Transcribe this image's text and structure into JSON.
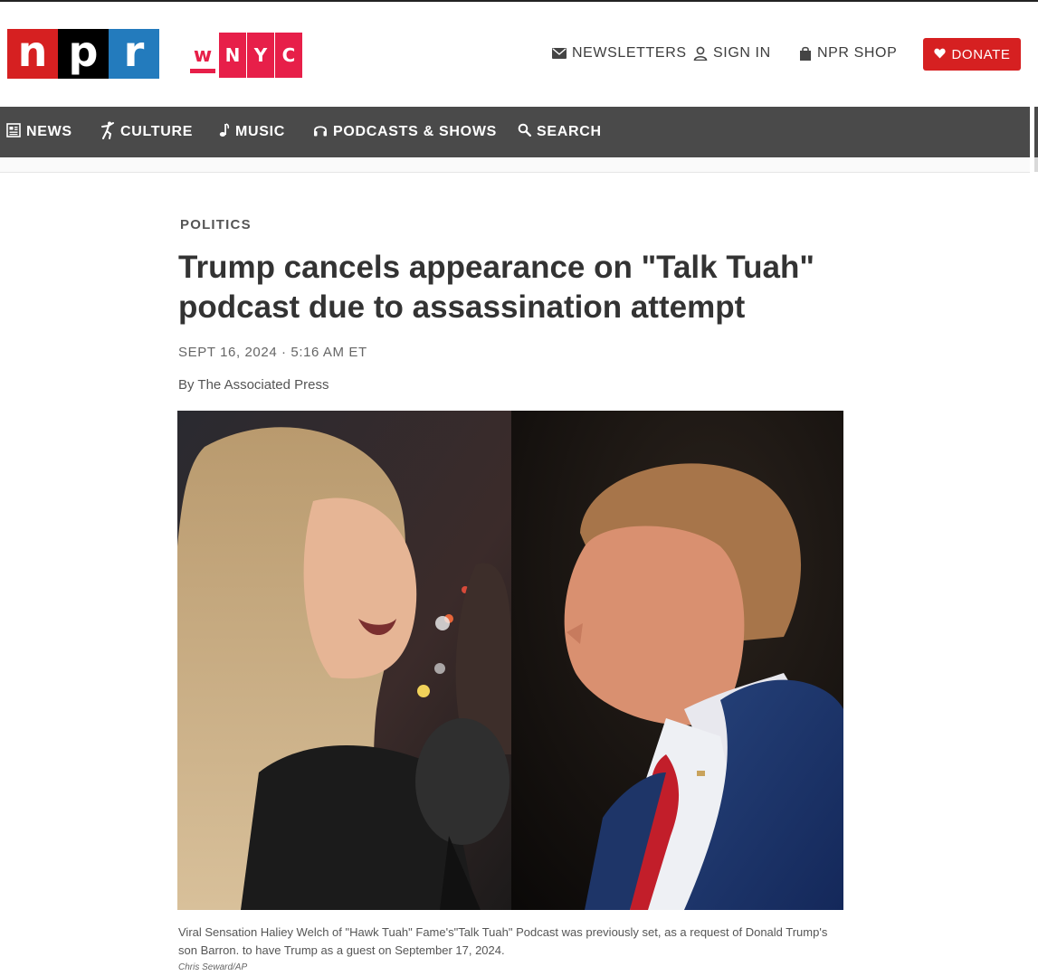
{
  "brand": {
    "npr_letters": [
      "n",
      "p",
      "r"
    ],
    "wnyc_letters": [
      "w",
      "N",
      "Y",
      "C"
    ],
    "colors": {
      "npr_red": "#d62021",
      "npr_black": "#000000",
      "npr_blue": "#237bbd",
      "wnyc_pink": "#e71f49",
      "nav_bg": "#4a4a4a"
    }
  },
  "utility": {
    "newsletters": "NEWSLETTERS",
    "sign_in": "SIGN IN",
    "shop": "NPR SHOP",
    "donate": "DONATE"
  },
  "nav": {
    "items": [
      {
        "label": "NEWS",
        "icon": "newspaper-icon"
      },
      {
        "label": "CULTURE",
        "icon": "dancer-icon"
      },
      {
        "label": "MUSIC",
        "icon": "music-note-icon"
      },
      {
        "label": "PODCASTS & SHOWS",
        "icon": "headphones-icon"
      },
      {
        "label": "SEARCH",
        "icon": "search-icon"
      }
    ]
  },
  "article": {
    "section": "POLITICS",
    "headline": "Trump cancels appearance on \"Talk Tuah\" podcast due to assassination attempt",
    "dateline": "SEPT 16, 2024 · 5:16 AM ET",
    "byline": "By The Associated Press",
    "caption": "Viral Sensation Haliey Welch of \"Hawk Tuah\" Fame's\"Talk Tuah\" Podcast was previously set, as a request of Donald Trump's son Barron. to have Trump as a guest on September 17, 2024.",
    "credit": "Chris Seward/AP"
  }
}
